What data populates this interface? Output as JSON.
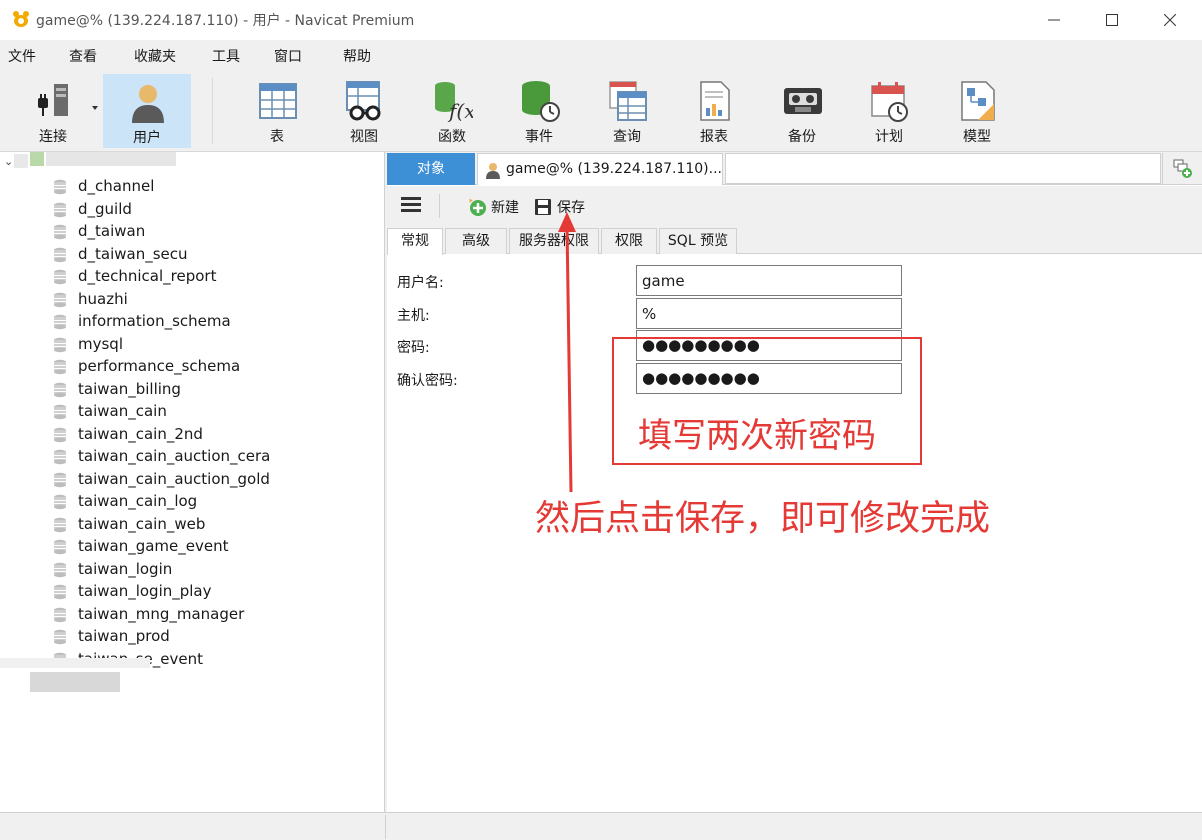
{
  "window": {
    "title": "game@% (139.224.187.110) - 用户 - Navicat Premium"
  },
  "menu": [
    "文件",
    "查看",
    "收藏夹",
    "工具",
    "窗口",
    "帮助"
  ],
  "toolbar": {
    "items": [
      {
        "label": "连接",
        "icon": "connection-icon"
      },
      {
        "label": "用户",
        "icon": "user-icon",
        "active": true
      },
      {
        "label": "表",
        "icon": "table-icon"
      },
      {
        "label": "视图",
        "icon": "view-icon"
      },
      {
        "label": "函数",
        "icon": "function-icon"
      },
      {
        "label": "事件",
        "icon": "event-icon"
      },
      {
        "label": "查询",
        "icon": "query-icon"
      },
      {
        "label": "报表",
        "icon": "report-icon"
      },
      {
        "label": "备份",
        "icon": "backup-icon"
      },
      {
        "label": "计划",
        "icon": "schedule-icon"
      },
      {
        "label": "模型",
        "icon": "model-icon"
      }
    ]
  },
  "sidebar": {
    "databases": [
      "d_channel",
      "d_guild",
      "d_taiwan",
      "d_taiwan_secu",
      "d_technical_report",
      "huazhi",
      "information_schema",
      "mysql",
      "performance_schema",
      "taiwan_billing",
      "taiwan_cain",
      "taiwan_cain_2nd",
      "taiwan_cain_auction_cera",
      "taiwan_cain_auction_gold",
      "taiwan_cain_log",
      "taiwan_cain_web",
      "taiwan_game_event",
      "taiwan_login",
      "taiwan_login_play",
      "taiwan_mng_manager",
      "taiwan_prod",
      "taiwan_se_event"
    ]
  },
  "tabs": {
    "objects": "对象",
    "document": "game@% (139.224.187.110)..."
  },
  "edit_toolbar": {
    "new_label": "新建",
    "save_label": "保存"
  },
  "subtabs": [
    "常规",
    "高级",
    "服务器权限",
    "权限",
    "SQL 预览"
  ],
  "form": {
    "username_label": "用户名:",
    "username_value": "game",
    "host_label": "主机:",
    "host_value": "%",
    "password_label": "密码:",
    "password_value": "●●●●●●●●●",
    "confirm_label": "确认密码:",
    "confirm_value": "●●●●●●●●●"
  },
  "annotations": {
    "text1": "填写两次新密码",
    "text2": "然后点击保存，即可修改完成",
    "color": "#e53935"
  }
}
